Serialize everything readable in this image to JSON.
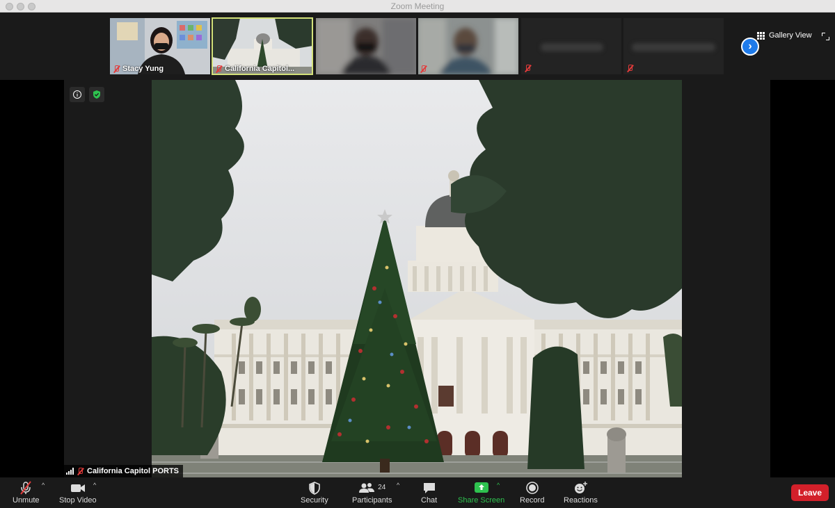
{
  "window": {
    "title": "Zoom Meeting"
  },
  "participants_strip": [
    {
      "name": "Stacy Yung",
      "muted": true,
      "active": false
    },
    {
      "name": "California Capitol...",
      "muted": true,
      "active": true
    },
    {
      "name": "",
      "muted": false,
      "active": false
    },
    {
      "name": "",
      "muted": false,
      "active": false
    },
    {
      "name": "",
      "muted": true,
      "active": false
    },
    {
      "name": "",
      "muted": true,
      "active": false
    }
  ],
  "view": {
    "gallery_label": "Gallery View"
  },
  "speaker": {
    "name": "California Capitol PORTS"
  },
  "toolbar": {
    "unmute": "Unmute",
    "stop_video": "Stop Video",
    "security": "Security",
    "participants": "Participants",
    "participants_count": "24",
    "chat": "Chat",
    "share_screen": "Share Screen",
    "record": "Record",
    "reactions": "Reactions",
    "leave": "Leave"
  },
  "colors": {
    "leave": "#d3202a",
    "share": "#2ec24f",
    "active_border": "#d4e27a",
    "next": "#1f7bea"
  }
}
